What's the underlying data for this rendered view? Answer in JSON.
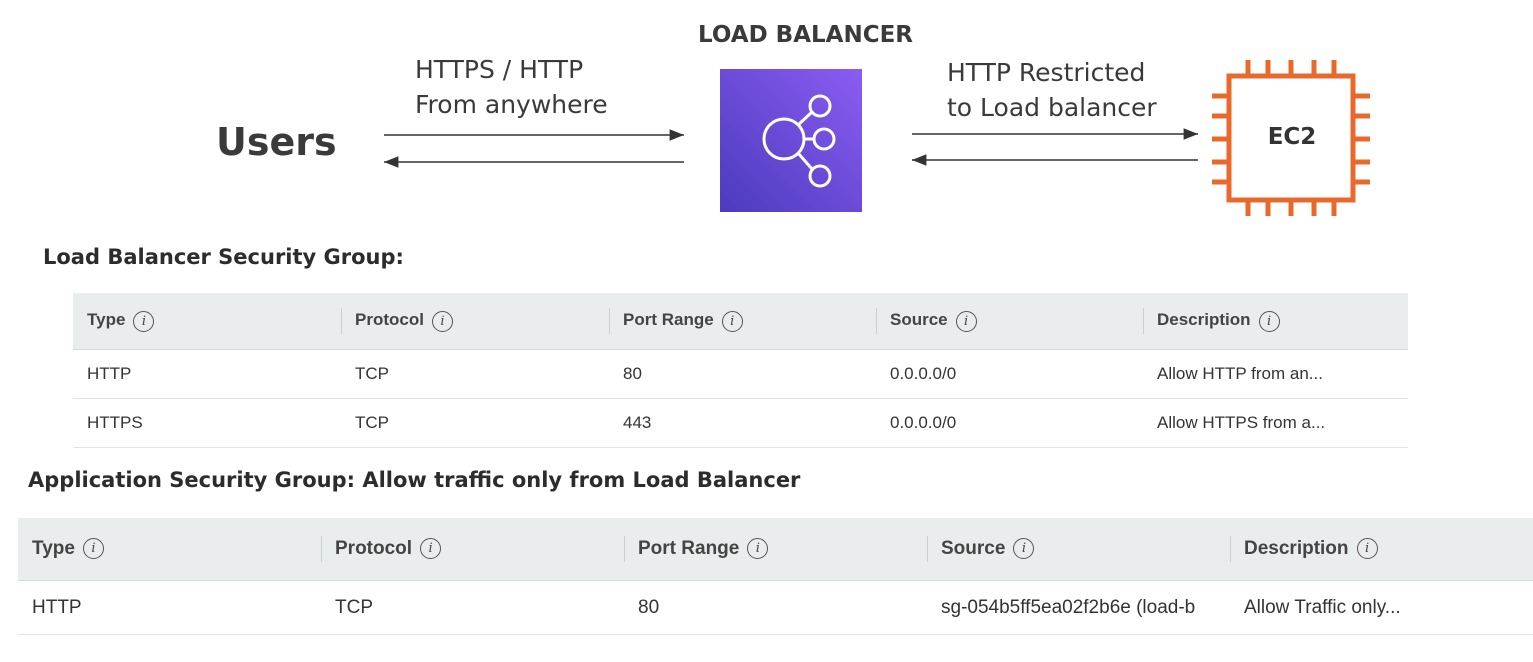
{
  "diagram": {
    "load_balancer_title": "LOAD BALANCER",
    "users_label": "Users",
    "edge_users_to_lb": [
      "HTTPS / HTTP",
      "From anywhere"
    ],
    "edge_lb_to_ec2": [
      "HTTP Restricted",
      "to Load balancer"
    ],
    "ec2_label": "EC2",
    "colors": {
      "load_balancer": "#7b4fe8",
      "ec2": "#e8692b"
    },
    "icons": [
      "load-balancer-icon",
      "ec2-chip-icon",
      "arrow-right-icon",
      "arrow-left-icon"
    ]
  },
  "lb_security_group": {
    "heading": "Load Balancer Security Group:",
    "columns": [
      "Type",
      "Protocol",
      "Port Range",
      "Source",
      "Description"
    ],
    "rows": [
      [
        "HTTP",
        "TCP",
        "80",
        "0.0.0.0/0",
        "Allow HTTP from an..."
      ],
      [
        "HTTPS",
        "TCP",
        "443",
        "0.0.0.0/0",
        "Allow HTTPS from a..."
      ]
    ]
  },
  "app_security_group": {
    "heading": "Application Security Group: Allow traffic only from Load Balancer",
    "columns": [
      "Type",
      "Protocol",
      "Port Range",
      "Source",
      "Description"
    ],
    "rows": [
      [
        "HTTP",
        "TCP",
        "80",
        "sg-054b5ff5ea02f2b6e (load-b",
        "Allow Traffic only..."
      ]
    ]
  }
}
